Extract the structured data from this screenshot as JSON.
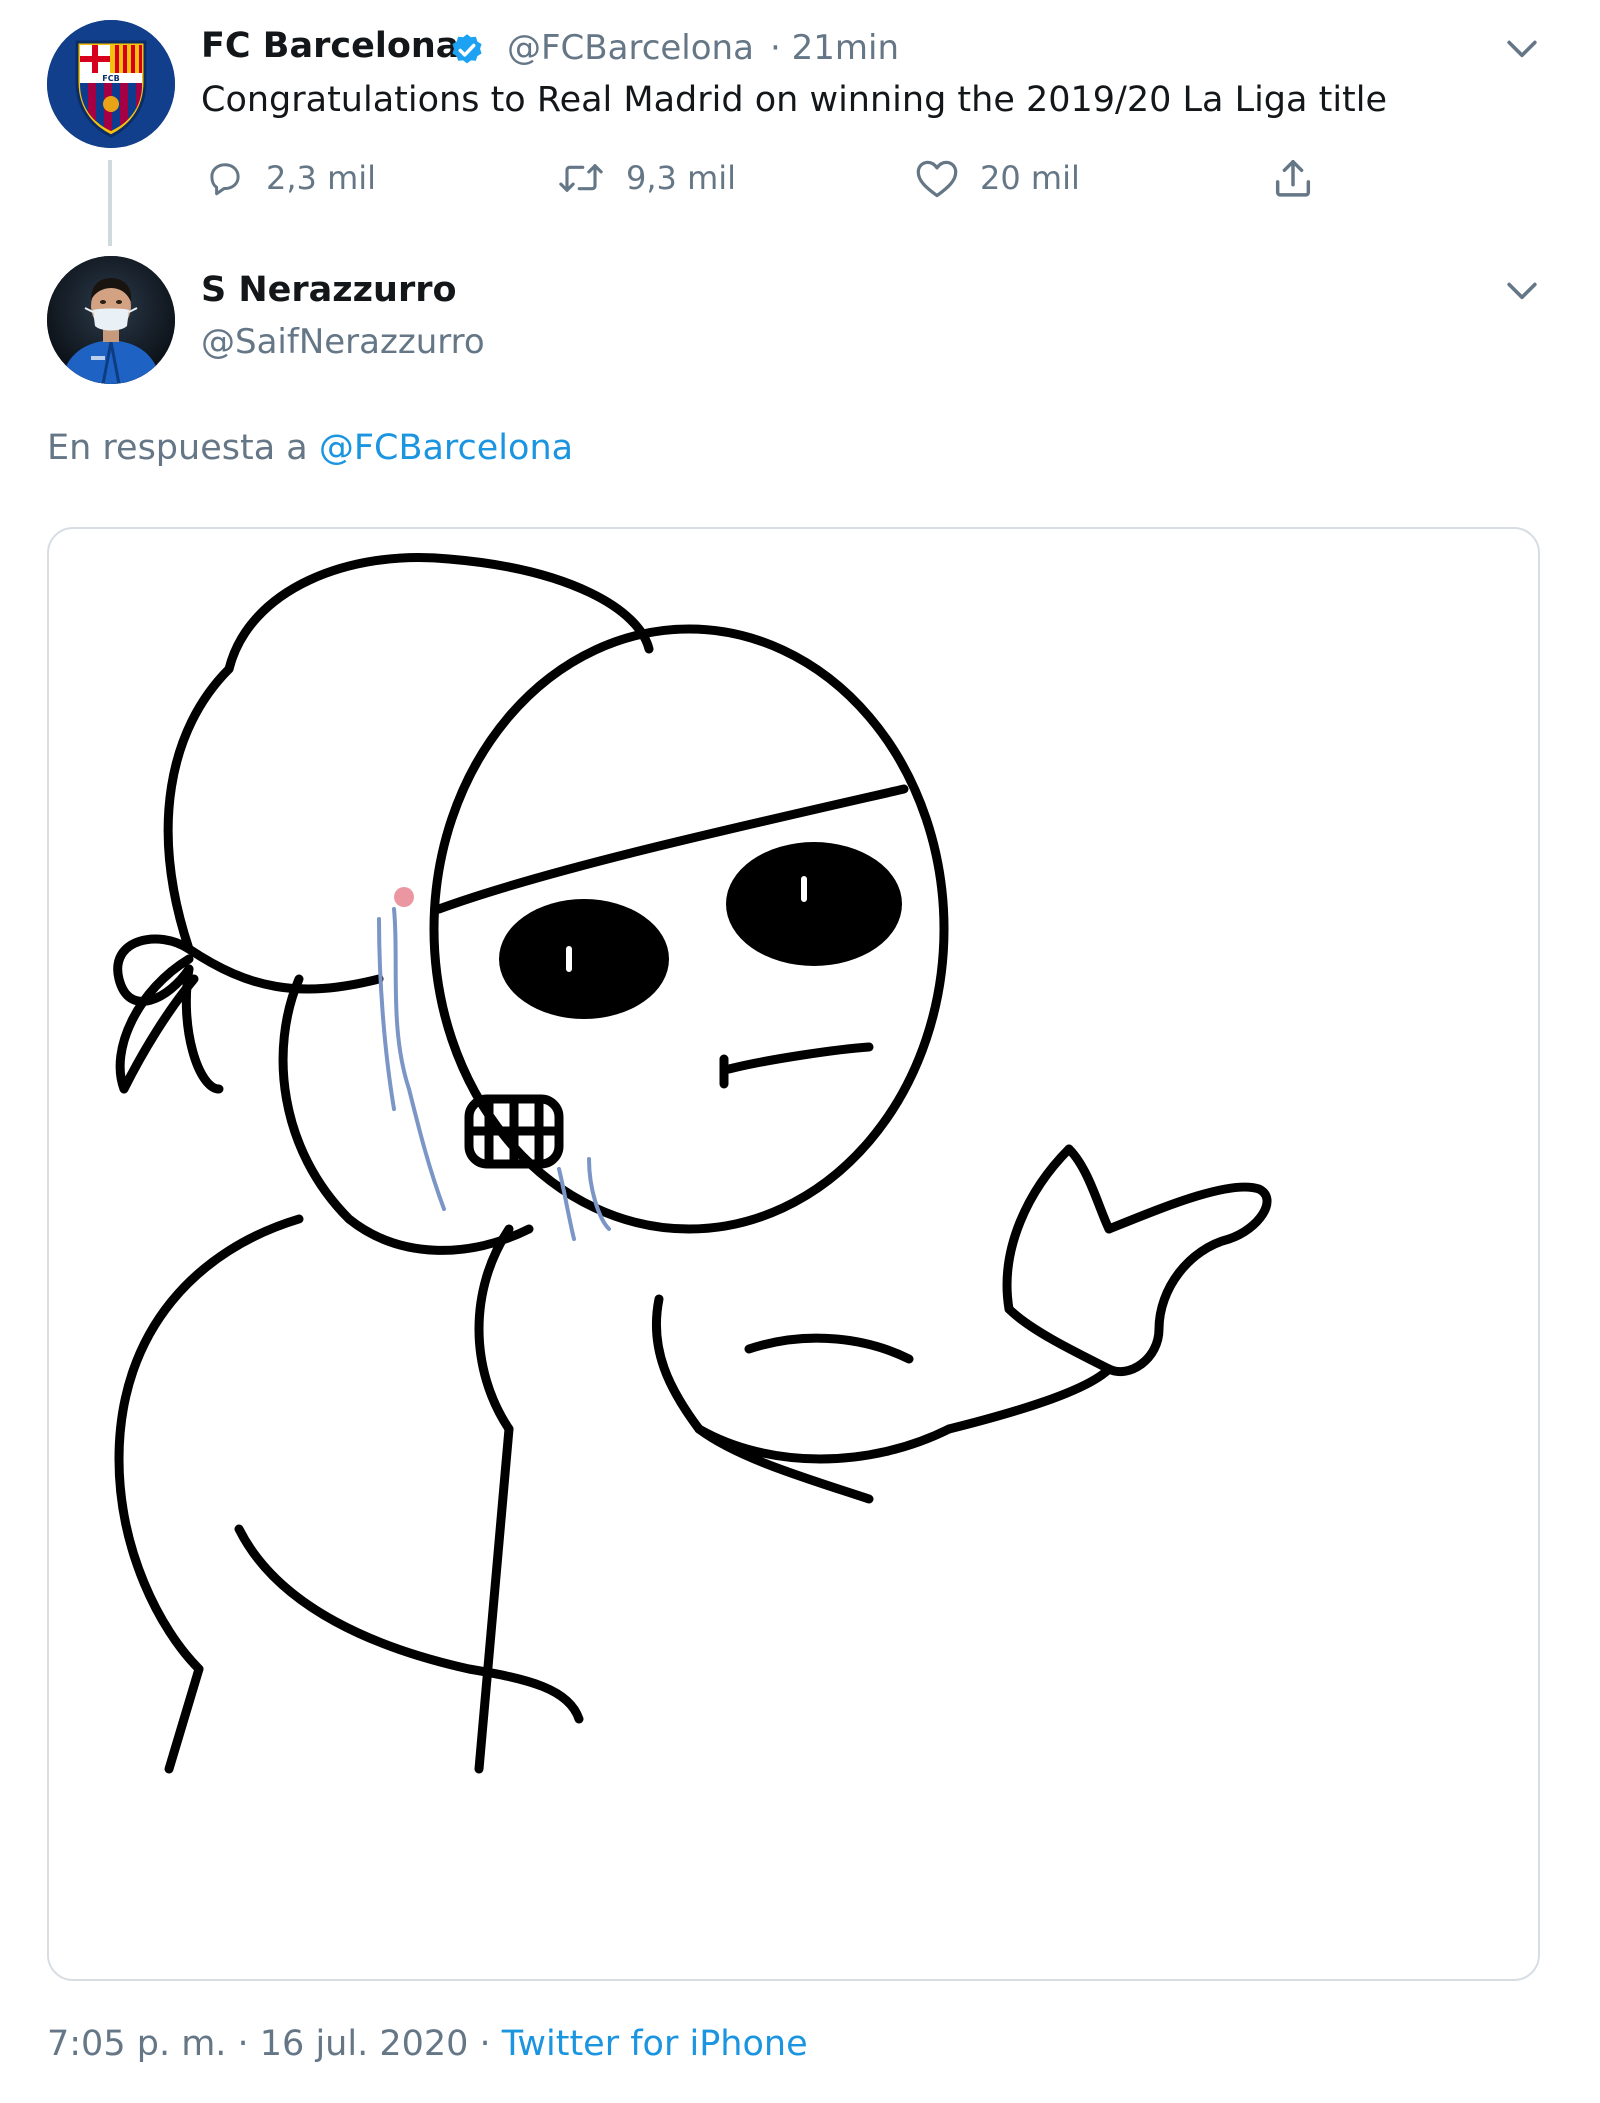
{
  "parent_tweet": {
    "display_name": "FC Barcelona",
    "handle": "@FCBarcelona",
    "time": "· 21min",
    "text": "Congratulations to Real Madrid on winning the 2019/20 La Liga title",
    "replies": "2,3 mil",
    "retweets": "9,3 mil",
    "likes": "20 mil",
    "avatar_crest_text": "FCB"
  },
  "reply_tweet": {
    "display_name": "S Nerazzurro",
    "handle": "@SaifNerazzurro",
    "reply_prefix": "En respuesta a",
    "reply_target": "@FCBarcelona",
    "date": "7:05 p. m. · 16 jul. 2020 ·",
    "source": "Twitter for iPhone"
  },
  "icons": {
    "verified": "verified-badge-icon",
    "reply": "reply-icon",
    "retweet": "retweet-icon",
    "like": "heart-icon",
    "share": "share-icon",
    "menu": "chevron-down-icon"
  },
  "colors": {
    "link": "#1b95e0",
    "muted": "#657786",
    "text": "#14171a",
    "barca_blue": "#0a3a86",
    "barca_red": "#a50044"
  }
}
